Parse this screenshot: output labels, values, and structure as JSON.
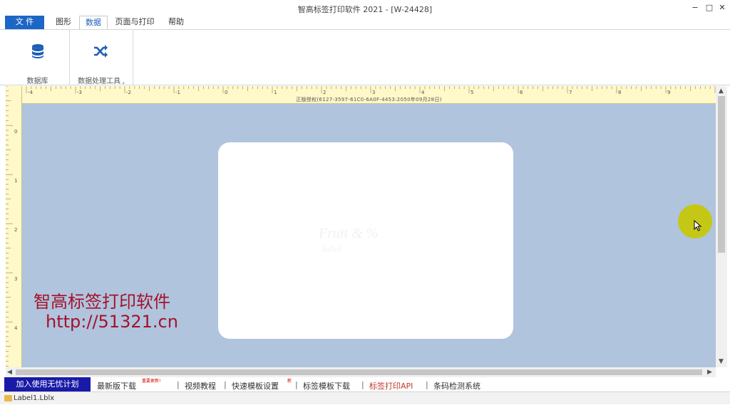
{
  "window": {
    "title": "智高标签打印软件 2021 - [W-24428]",
    "minimize": "−",
    "maximize": "□",
    "close": "✕"
  },
  "tabs": [
    {
      "label": "文 件"
    },
    {
      "label": "图形"
    },
    {
      "label": "数据"
    },
    {
      "label": "页面与打印"
    },
    {
      "label": "帮助"
    }
  ],
  "ribbon": {
    "groups": [
      {
        "label": "数据库",
        "icon": "database-icon"
      },
      {
        "label": "数据处理工具",
        "icon": "shuffle-icon"
      }
    ],
    "group_launcher": "⌟"
  },
  "ruler": {
    "caption": "正版授权(6127-3597-61C0-6A0F-4453:2050年09月28日)",
    "h_labels": [
      "-4",
      "-3",
      "-2",
      "-1",
      "0",
      "1",
      "2",
      "3",
      "4",
      "5",
      "6",
      "7",
      "8",
      "9"
    ],
    "v_labels": [
      "0",
      "1",
      "2",
      "3",
      "4"
    ]
  },
  "watermark": {
    "line1": "智高标签打印软件",
    "line2": "http://51321.cn"
  },
  "linkbar": {
    "promo": "加入使用无忧计划",
    "links": [
      "最新版下载",
      "视频教程",
      "快速模板设置",
      "标签模板下载",
      "标签打印API",
      "条码检测系统"
    ],
    "latest_badge": "重要更新!",
    "new_badge": "新",
    "separator": "|"
  },
  "status": {
    "document": "Label1.Lblx"
  },
  "colors": {
    "accent": "#1c66c6",
    "canvas": "#b0c4de",
    "ruler": "#fff8c8",
    "watermark": "#a5122a",
    "api_link": "#c0392b"
  }
}
